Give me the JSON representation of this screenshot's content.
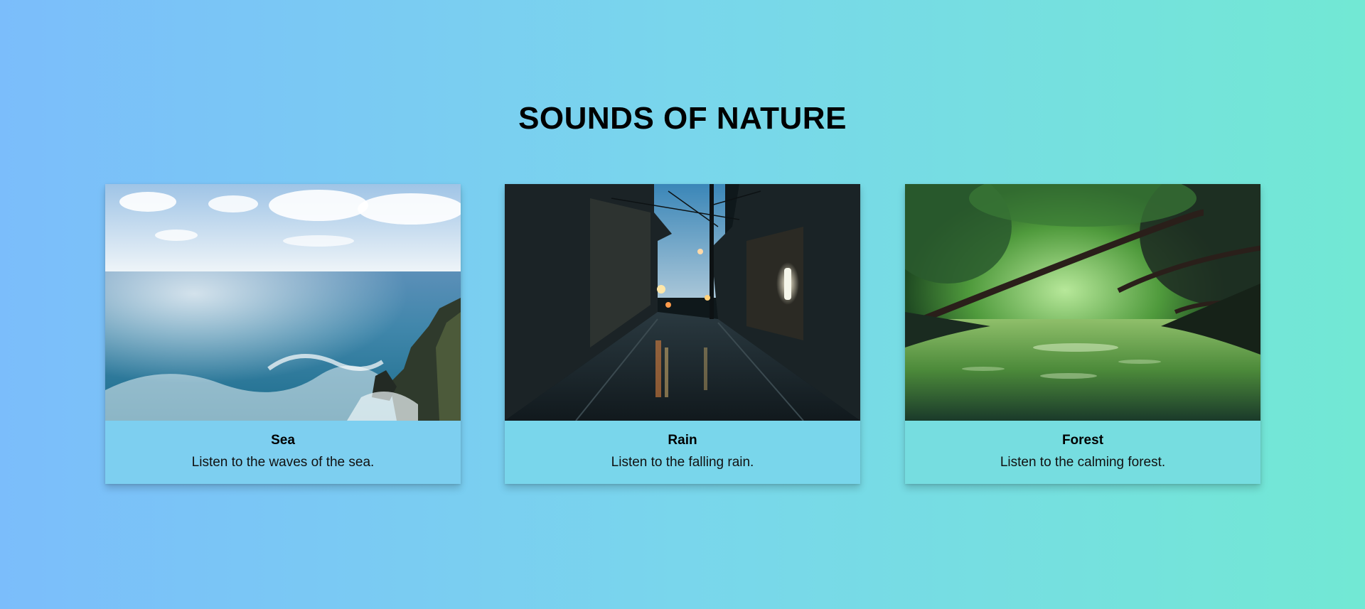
{
  "page": {
    "title": "SOUNDS OF NATURE"
  },
  "cards": [
    {
      "title": "Sea",
      "description": "Listen to the waves of the sea.",
      "image": "sea-cliff-photo"
    },
    {
      "title": "Rain",
      "description": "Listen to the falling rain.",
      "image": "rainy-street-photo"
    },
    {
      "title": "Forest",
      "description": "Listen to the calming forest.",
      "image": "forest-river-photo"
    }
  ],
  "colors": {
    "gradient_start": "#7bbdfb",
    "gradient_end": "#72e8d4"
  }
}
